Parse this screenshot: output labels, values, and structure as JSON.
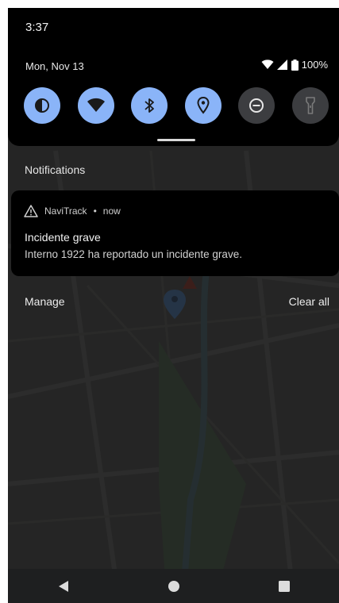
{
  "status_bar": {
    "time": "3:37",
    "date": "Mon, Nov 13",
    "battery": "100%"
  },
  "quick_settings": {
    "tiles": [
      {
        "icon": "invert-colors-icon",
        "state": "on"
      },
      {
        "icon": "wifi-icon",
        "state": "on"
      },
      {
        "icon": "bluetooth-icon",
        "state": "on"
      },
      {
        "icon": "location-icon",
        "state": "on"
      },
      {
        "icon": "do-not-disturb-icon",
        "state": "off"
      },
      {
        "icon": "flashlight-icon",
        "state": "off"
      }
    ],
    "accent_color": "#8ab4f8"
  },
  "notifications": {
    "section_title": "Notifications",
    "items": [
      {
        "app_name": "NaviTrack",
        "time": "now",
        "title": "Incidente grave",
        "text": "Interno 1922 ha reportado un incidente grave."
      }
    ],
    "manage_label": "Manage",
    "clear_all_label": "Clear all"
  },
  "nav_bar": {
    "icons": [
      "back-icon",
      "home-icon",
      "recents-icon"
    ]
  }
}
